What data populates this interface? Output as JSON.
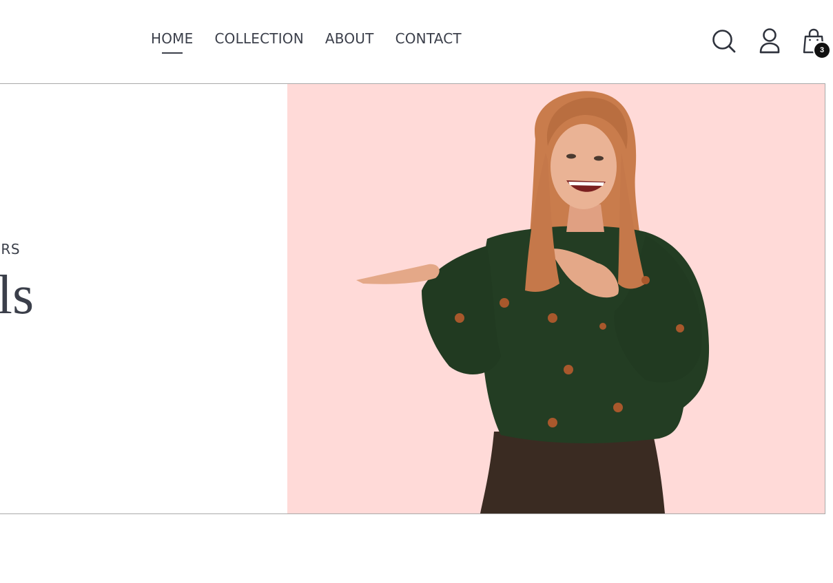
{
  "nav": {
    "items": [
      {
        "label": "HOME",
        "active": true
      },
      {
        "label": "COLLECTION",
        "active": false
      },
      {
        "label": "ABOUT",
        "active": false
      },
      {
        "label": "CONTACT",
        "active": false
      }
    ]
  },
  "header_icons": {
    "search": "search-icon",
    "account": "user-icon",
    "cart": "shopping-bag-icon",
    "cart_count": "3"
  },
  "hero": {
    "eyebrow": "LLERS",
    "title": "Arrivals",
    "image_background": "#ffdad8"
  },
  "colors": {
    "text": "#3b3f4a",
    "badge": "#111111",
    "hero_bg": "#ffdad8"
  }
}
